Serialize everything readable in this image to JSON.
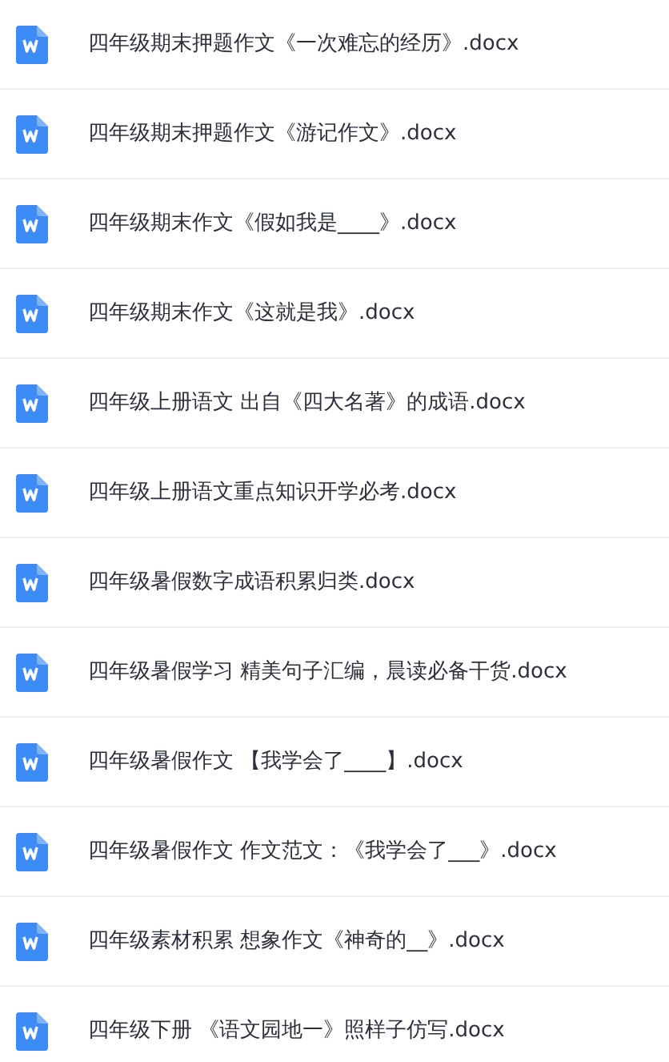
{
  "files": [
    {
      "name": "四年级期末押题作文《一次难忘的经历》.docx"
    },
    {
      "name": "四年级期末押题作文《游记作文》.docx"
    },
    {
      "name": "四年级期末作文《假如我是____》.docx"
    },
    {
      "name": "四年级期末作文《这就是我》.docx"
    },
    {
      "name": "四年级上册语文 出自《四大名著》的成语.docx"
    },
    {
      "name": "四年级上册语文重点知识开学必考.docx"
    },
    {
      "name": "四年级暑假数字成语积累归类.docx"
    },
    {
      "name": "四年级暑假学习 精美句子汇编，晨读必备干货.docx"
    },
    {
      "name": "四年级暑假作文 【我学会了____】.docx"
    },
    {
      "name": "四年级暑假作文 作文范文：《我学会了___》.docx"
    },
    {
      "name": "四年级素材积累 想象作文《神奇的__》.docx"
    },
    {
      "name": "四年级下册 《语文园地一》照样子仿写.docx"
    }
  ]
}
